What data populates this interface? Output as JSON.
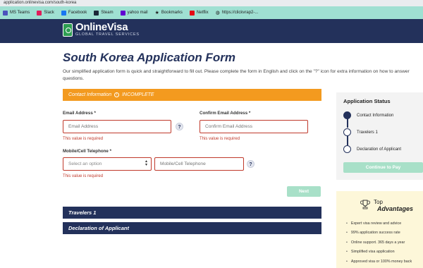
{
  "browser": {
    "url": "application.onlinevisa.com/south-korea",
    "bookmarks": [
      {
        "label": "MS Teams",
        "icon": "ms-teams-icon",
        "color": "#4b53bc"
      },
      {
        "label": "Slack",
        "icon": "slack-icon",
        "color": "#e01e5a"
      },
      {
        "label": "Facebook",
        "icon": "facebook-icon",
        "color": "#1877f2"
      },
      {
        "label": "Steam",
        "icon": "steam-icon",
        "color": "#1b2838"
      },
      {
        "label": "yahoo mail",
        "icon": "yahoo-mail-icon",
        "color": "#6001d2"
      },
      {
        "label": "Bookmarks",
        "icon": "star-icon",
        "color": "#333333"
      },
      {
        "label": "Netflix",
        "icon": "netflix-icon",
        "color": "#e50914"
      },
      {
        "label": "https://clickvrap2-...",
        "icon": "globe-icon",
        "color": "#555555"
      }
    ]
  },
  "site": {
    "logo_title": "OnlineVisa",
    "logo_subtitle": "GLOBAL TRAVEL SERVICES"
  },
  "main": {
    "title": "South Korea Application Form",
    "intro": "Our simplified application form is quick and straightforward to fill out. Please complete the form in English and click on the \"?\" icon for extra information on how to answer questions.",
    "contact_section": {
      "label": "Contact Information",
      "info_glyph": "i",
      "status": "INCOMPLETE"
    },
    "email": {
      "label": "Email Address *",
      "placeholder": "Email Address",
      "error": "This value is required"
    },
    "confirm_email": {
      "label": "Confirm Email Address *",
      "placeholder": "Confirm Email Address",
      "error": "This value is required"
    },
    "phone": {
      "label": "Mobile/Cell Telephone *",
      "select_placeholder": "Select an option",
      "placeholder": "Mobile/Cell Telephone",
      "error": "This value is required"
    },
    "help_glyph": "?",
    "next_label": "Next",
    "travelers_section": "Travelers 1",
    "declaration_section": "Declaration of Applicant"
  },
  "status": {
    "title": "Application Status",
    "steps": [
      {
        "label": "Contact Information",
        "active": true
      },
      {
        "label": "Travelers 1",
        "active": false
      },
      {
        "label": "Declaration of Applicant",
        "active": false
      }
    ],
    "continue_label": "Continue to Pay"
  },
  "advantages": {
    "top": "Top",
    "title": "Advantages",
    "items": [
      "Expert visa review and advice",
      "99% application success rate",
      "Online support. 365 days a year",
      "Simplified visa application",
      "Approved visa or 100% money back"
    ]
  },
  "colors": {
    "navy": "#23315b",
    "orange": "#f39a1f",
    "error": "#c0392b",
    "button_disabled": "#a8e0c8",
    "bookmark_bar": "#9fe0d2"
  }
}
